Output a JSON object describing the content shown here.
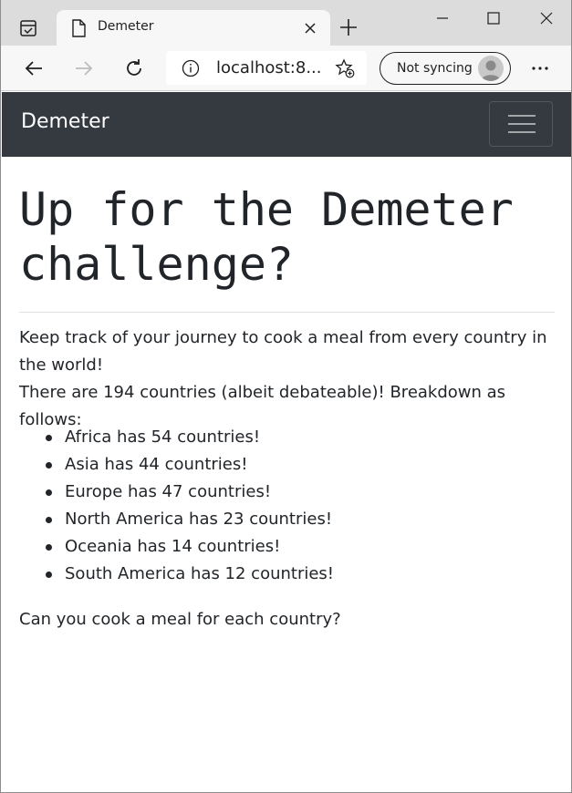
{
  "browser": {
    "tab": {
      "title": "Demeter"
    },
    "address_bar": {
      "url": "localhost:8..."
    },
    "profile": {
      "sync_label": "Not syncing"
    },
    "icons": {
      "tab_actions": "tab-actions-icon",
      "favicon": "page-icon",
      "close_tab": "close-icon",
      "new_tab": "plus-icon",
      "minimize": "minimize-icon",
      "maximize": "maximize-icon",
      "close_window": "close-icon",
      "back": "arrow-left-icon",
      "forward": "arrow-right-icon",
      "refresh": "refresh-icon",
      "site_info": "info-icon",
      "favorites": "star-add-icon",
      "more": "more-icon"
    }
  },
  "navbar": {
    "brand": "Demeter",
    "background": "#343a40",
    "toggler_icon": "menu-icon"
  },
  "main": {
    "heading": "Up for the Demeter challenge?",
    "intro_line1": "Keep track of your journey to cook a meal from every country in the world!",
    "intro_line2": "There are 194 countries (albeit debateable)! Breakdown as follows:",
    "continents": [
      "Africa has 54 countries!",
      "Asia has 44 countries!",
      "Europe has 47 countries!",
      "North America has 23 countries!",
      "Oceania has 14 countries!",
      "South America has 12 countries!"
    ],
    "closing": "Can you cook a meal for each country?"
  }
}
